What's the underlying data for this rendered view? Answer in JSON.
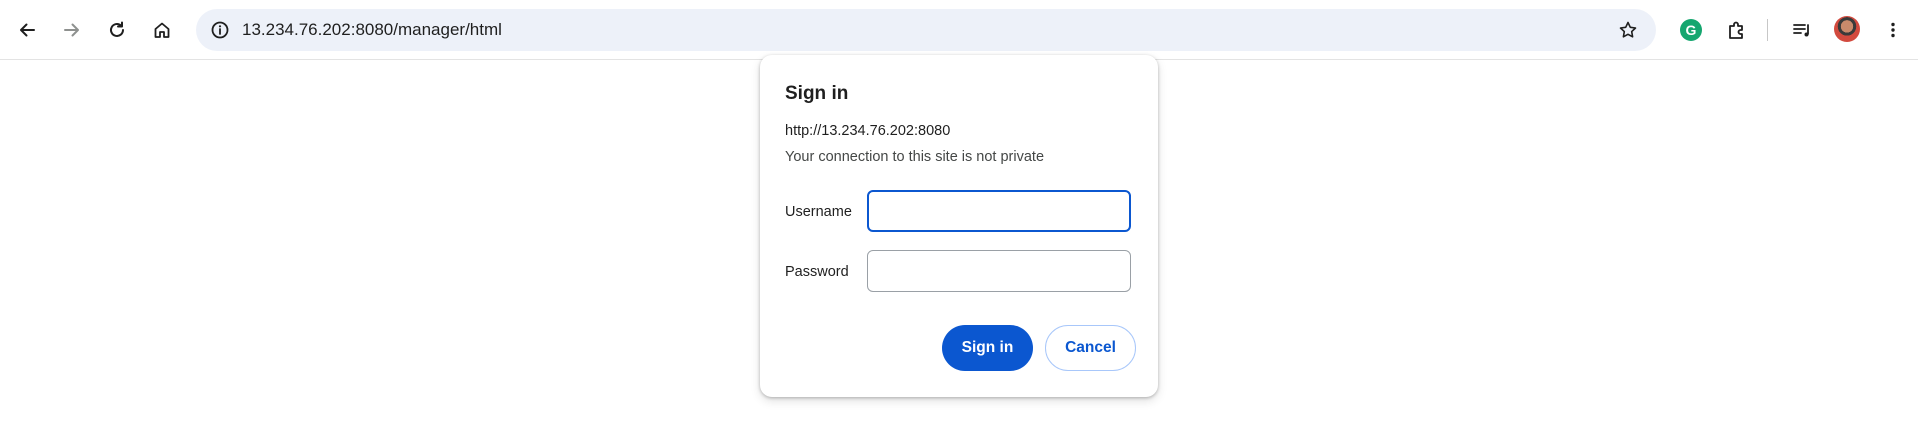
{
  "browser": {
    "url": "13.234.76.202:8080/manager/html",
    "icons": {
      "back": "arrow-left-icon",
      "forward": "arrow-right-icon",
      "reload": "reload-icon",
      "home": "home-icon",
      "site_info": "info-icon",
      "bookmark": "star-icon",
      "grammarly": "grammarly-icon",
      "extensions": "puzzle-icon",
      "media": "media-controls-icon",
      "profile": "avatar",
      "menu": "kebab-menu-icon"
    },
    "grammarly_letter": "G"
  },
  "dialog": {
    "title": "Sign in",
    "origin": "http://13.234.76.202:8080",
    "warning": "Your connection to this site is not private",
    "username_label": "Username",
    "username_value": "",
    "password_label": "Password",
    "password_value": "",
    "sign_in_label": "Sign in",
    "cancel_label": "Cancel"
  },
  "colors": {
    "accent": "#0b57d0",
    "omnibox_bg": "#edf1f9",
    "grammarly": "#15a66f"
  }
}
